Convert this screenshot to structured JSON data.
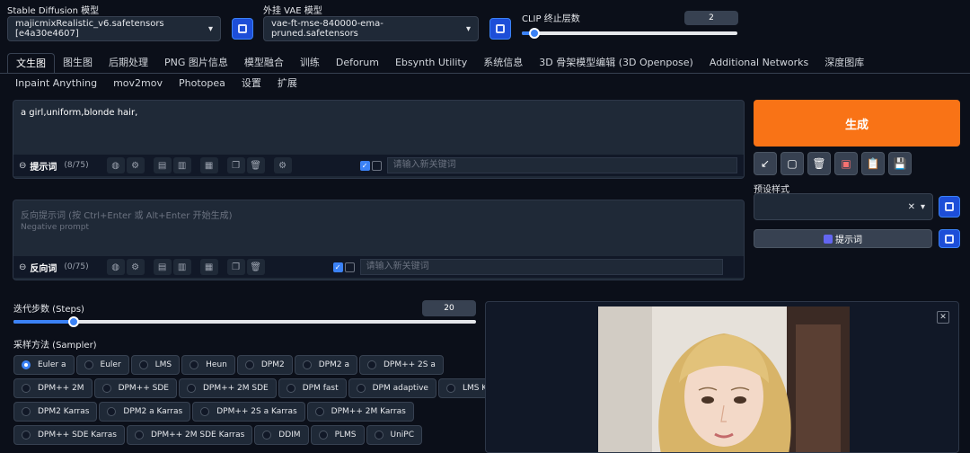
{
  "model": {
    "label": "Stable Diffusion 模型",
    "value": "majicmixRealistic_v6.safetensors [e4a30e4607]"
  },
  "vae": {
    "label": "外挂 VAE 模型",
    "value": "vae-ft-mse-840000-ema-pruned.safetensors"
  },
  "clip": {
    "label": "CLIP 终止层数",
    "value": "2",
    "level": 0.06
  },
  "tabs_row1": [
    "文生图",
    "图生图",
    "后期处理",
    "PNG 图片信息",
    "模型融合",
    "训练",
    "Deforum",
    "Ebsynth Utility",
    "系统信息",
    "3D 骨架模型编辑 (3D Openpose)",
    "Additional Networks",
    "深度图库"
  ],
  "tabs_row2": [
    "Inpaint Anything",
    "mov2mov",
    "Photopea",
    "设置",
    "扩展"
  ],
  "prompt": {
    "text": "a girl,uniform,blonde hair,",
    "label": "提示词",
    "count": "(8/75)",
    "keyword_placeholder": "请输入新关键词"
  },
  "negative": {
    "placeholder1": "反向提示词 (按 Ctrl+Enter 或 Alt+Enter 开始生成)",
    "placeholder2": "Negative prompt",
    "label": "反向词",
    "count": "(0/75)",
    "keyword_placeholder": "请输入新关键词"
  },
  "generate_label": "生成",
  "styles_label": "预设样式",
  "prompt_button_label": "提示词",
  "steps": {
    "label": "迭代步数 (Steps)",
    "value": "20",
    "level": 0.13
  },
  "sampler": {
    "label": "采样方法 (Sampler)",
    "selected": "Euler a",
    "rows": [
      [
        "Euler a",
        "Euler",
        "LMS",
        "Heun",
        "DPM2",
        "DPM2 a",
        "DPM++ 2S a"
      ],
      [
        "DPM++ 2M",
        "DPM++ SDE",
        "DPM++ 2M SDE",
        "DPM fast",
        "DPM adaptive",
        "LMS Karras"
      ],
      [
        "DPM2 Karras",
        "DPM2 a Karras",
        "DPM++ 2S a Karras",
        "DPM++ 2M Karras"
      ],
      [
        "DPM++ SDE Karras",
        "DPM++ 2M SDE Karras",
        "DDIM",
        "PLMS",
        "UniPC"
      ]
    ]
  },
  "colors": {
    "accent": "#3b82f6",
    "generate": "#f97316",
    "background": "#0b0f19"
  }
}
